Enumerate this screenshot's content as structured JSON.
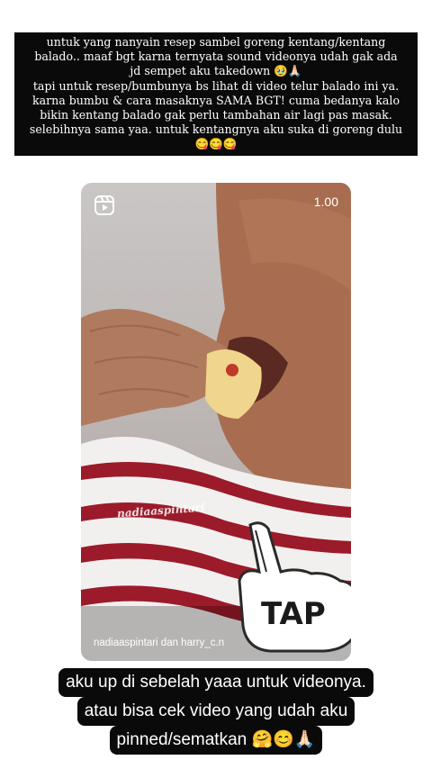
{
  "top_caption": {
    "lines": [
      "untuk yang nanyain resep sambel goreng kentang/kentang",
      "balado.. maaf bgt karna ternyata sound videonya udah gak ada",
      "jd sempet aku takedown 🥹🙏🏻",
      "tapi untuk resep/bumbunya bs lihat di video telur balado ini ya.",
      "karna bumbu & cara masaknya SAMA BGT! cuma bedanya kalo",
      "bikin kentang balado gak perlu tambahan air lagi pas masak.",
      "selebihnya sama yaa. untuk kentangnya aku suka di goreng dulu",
      "😋😋😋"
    ]
  },
  "reel": {
    "timer": "1.00",
    "watermark": "nadiaaspintari",
    "credit": "nadiaaspintari dan harry_c.n",
    "sticker_text": "TAP",
    "reels_icon": "reels-icon",
    "hand_icon": "pointing-hand-icon"
  },
  "bottom_caption": {
    "lines": [
      "aku up di sebelah yaaa untuk videonya.",
      "atau bisa cek video yang udah aku",
      "pinned/sematkan 🤗😊🙏🏻"
    ]
  }
}
